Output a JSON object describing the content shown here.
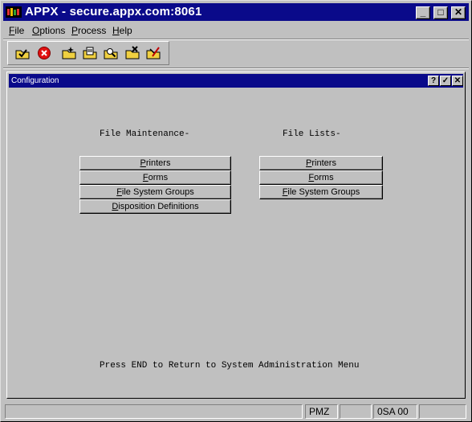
{
  "window": {
    "title": "APPX - secure.appx.com:8061",
    "controls": {
      "minimize": "_",
      "maximize": "□",
      "close": "✕"
    }
  },
  "menubar": {
    "items": [
      {
        "label": "File",
        "mnemonic_index": 0
      },
      {
        "label": "Options",
        "mnemonic_index": 0
      },
      {
        "label": "Process",
        "mnemonic_index": 0
      },
      {
        "label": "Help",
        "mnemonic_index": 0
      }
    ]
  },
  "toolbar": {
    "tools": [
      {
        "icon": "check-folder-icon"
      },
      {
        "icon": "cancel-icon"
      },
      {
        "icon": "new-folder-icon"
      },
      {
        "icon": "edit-folder-icon"
      },
      {
        "icon": "search-folder-icon"
      },
      {
        "icon": "delete-folder-icon"
      },
      {
        "icon": "remove-folder-icon"
      }
    ]
  },
  "child_window": {
    "title": "Configuration",
    "controls": {
      "help": "?",
      "ok": "✓",
      "close": "✕"
    }
  },
  "form": {
    "maintenance_heading": "File Maintenance-",
    "lists_heading": "File Lists-",
    "maintenance_buttons": [
      {
        "label": "Printers"
      },
      {
        "label": "Forms"
      },
      {
        "label": "File System Groups"
      },
      {
        "label": "Disposition Definitions"
      }
    ],
    "lists_buttons": [
      {
        "label": "Printers"
      },
      {
        "label": "Forms"
      },
      {
        "label": "File System Groups"
      }
    ],
    "footer_text": "Press END to Return to System Administration Menu"
  },
  "status": {
    "panels": [
      "",
      "PMZ",
      "",
      "0SA 00",
      ""
    ]
  }
}
